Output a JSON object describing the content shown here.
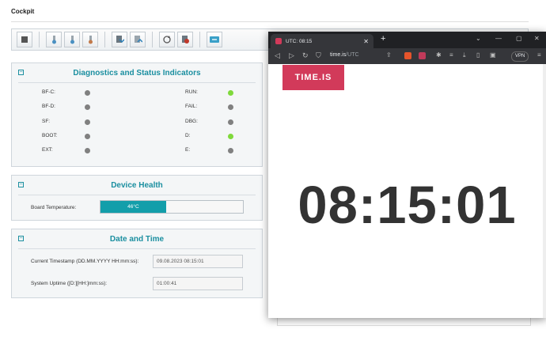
{
  "app": {
    "title": "Cockpit"
  },
  "diagnostics": {
    "title": "Diagnostics and Status Indicators",
    "left": [
      {
        "label": "BF-C:",
        "state": "off"
      },
      {
        "label": "BF-D:",
        "state": "off"
      },
      {
        "label": "SF:",
        "state": "off"
      },
      {
        "label": "BOOT:",
        "state": "off"
      },
      {
        "label": "EXT:",
        "state": "off"
      }
    ],
    "right": [
      {
        "label": "RUN:",
        "state": "on"
      },
      {
        "label": "FAIL:",
        "state": "off"
      },
      {
        "label": "DBG:",
        "state": "off"
      },
      {
        "label": "D:",
        "state": "on"
      },
      {
        "label": "E:",
        "state": "off"
      }
    ],
    "colors": {
      "on": "#7fd93b",
      "off": "#808080"
    }
  },
  "health": {
    "title": "Device Health",
    "board_temp_label": "Board Temperature:",
    "board_temp_value": "46°C",
    "board_temp_fraction": 0.46
  },
  "datetime": {
    "title": "Date and Time",
    "timestamp_label": "Current Timestamp (DD.MM.YYYY HH:mm:ss):",
    "timestamp_value": "09.08.2023  08:15:01",
    "uptime_label": "System Uptime ([D:][HH:]mm:ss):",
    "uptime_value": "01:00:41"
  },
  "browser": {
    "tab_title": "UTC: 08:15",
    "new_tab": "+",
    "url_host": "time.is",
    "url_path": "/UTC",
    "vpn": "VPN",
    "logo": "TIME.IS",
    "clock": "08:15:01"
  }
}
